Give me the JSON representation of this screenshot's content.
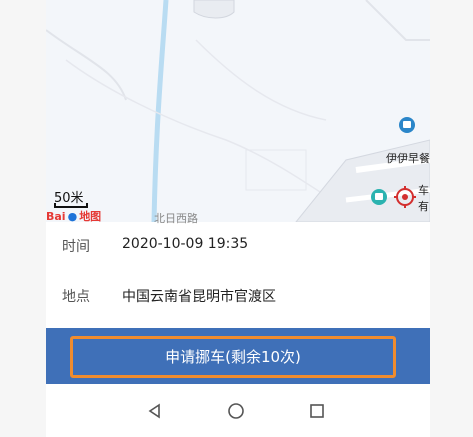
{
  "map": {
    "scale_label": "50米",
    "logo_text": "Bai",
    "logo_suffix": "地图",
    "road_label_bottom": "北日西路",
    "poi_name": "伊伊早餐",
    "poi_right_1": "车",
    "poi_right_2": "有"
  },
  "details": {
    "time_label": "时间",
    "time_value": "2020-10-09 19:35",
    "location_label": "地点",
    "location_value": "中国云南省昆明市官渡区"
  },
  "action": {
    "move_car_label": "申请挪车(剩余10次)"
  },
  "colors": {
    "action_bar": "#3f70b8",
    "button_border": "#f08c2e"
  }
}
